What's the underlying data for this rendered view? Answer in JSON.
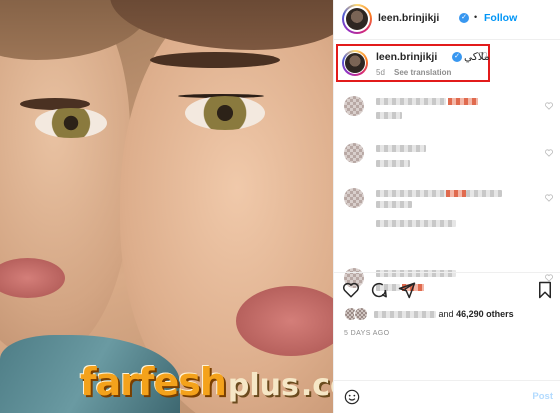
{
  "post": {
    "username": "leen.brinjikji",
    "follow_label": "Follow",
    "separator": "•",
    "more_glyph": "···"
  },
  "caption": {
    "username": "leen.brinjikji",
    "text": "ملاكي",
    "emoji": "♡",
    "time": "5d",
    "see_translation": "See translation"
  },
  "comments": [
    {
      "time_label": ""
    },
    {
      "time_label": ""
    },
    {
      "time_label": ""
    },
    {
      "time_label": ""
    }
  ],
  "likes": {
    "count": "46,290 others",
    "conjunction": "and"
  },
  "timestamp": "5 DAYS AGO",
  "add_comment": {
    "post_label": "Post"
  },
  "watermark": {
    "brand": "farfesh",
    "suffix": "plus",
    "tld": ".com"
  },
  "colors": {
    "verified": "#3897f0",
    "follow": "#0095f6",
    "highlight_box": "#e21b1b",
    "post_disabled": "#b3dbff",
    "watermark_orange": "#f4a21b"
  },
  "icons": {
    "like": "heart-icon",
    "comment": "comment-icon",
    "share": "paper-plane-icon",
    "save": "bookmark-icon",
    "emoji": "smiley-icon",
    "verified": "verified-badge-icon"
  }
}
